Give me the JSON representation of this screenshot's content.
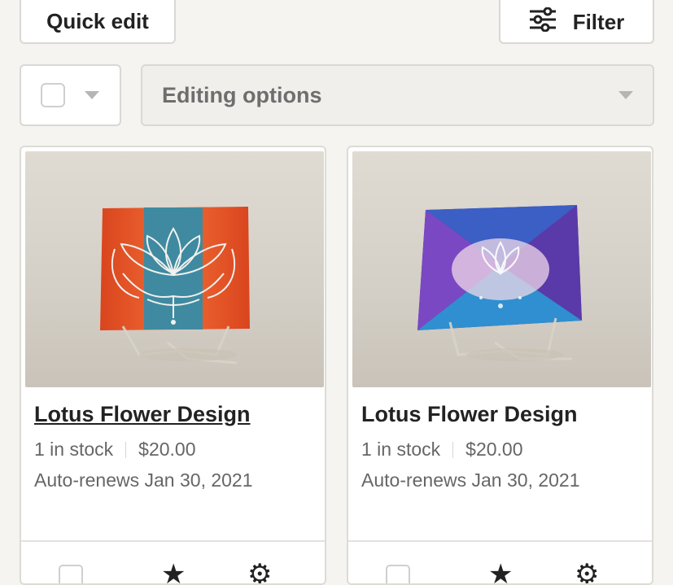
{
  "toolbar": {
    "quick_edit_label": "Quick edit",
    "filter_label": "Filter",
    "filter_icon": "sliders-icon",
    "editing_options_label": "Editing options"
  },
  "listings": [
    {
      "title": "Lotus Flower Design",
      "stock": "1 in stock",
      "price": "$20.00",
      "renews": "Auto-renews Jan 30, 2021",
      "image": "orange-teal-lotus-painting"
    },
    {
      "title": "Lotus Flower Design",
      "stock": "1 in stock",
      "price": "$20.00",
      "renews": "Auto-renews Jan 30, 2021",
      "image": "purple-blue-lotus-painting"
    }
  ],
  "colors": {
    "background": "#f5f4f0",
    "border": "#d9d8d4",
    "text": "#222222",
    "muted": "#666666"
  }
}
